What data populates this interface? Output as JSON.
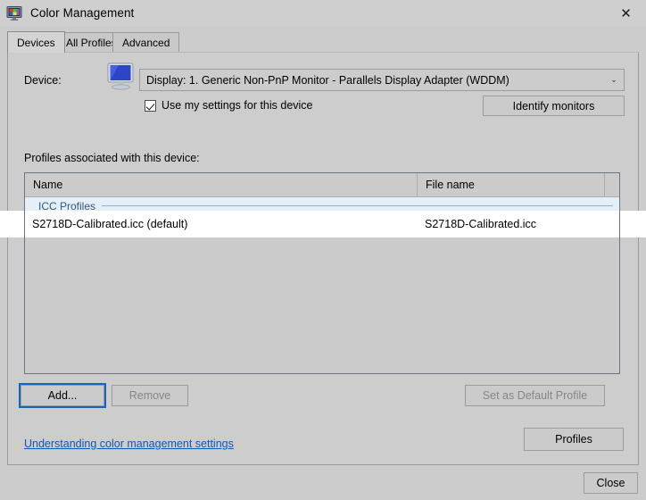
{
  "window": {
    "title": "Color Management",
    "icon": "color-monitor-icon",
    "close_glyph": "✕"
  },
  "tabs": [
    {
      "label": "Devices",
      "active": true
    },
    {
      "label": "All Profiles",
      "active": false
    },
    {
      "label": "Advanced",
      "active": false
    }
  ],
  "device": {
    "label": "Device:",
    "icon": "monitor-icon",
    "selected": "Display: 1. Generic Non-PnP Monitor - Parallels Display Adapter (WDDM)",
    "dropdown_glyph": "⌄",
    "use_my_settings": {
      "label": "Use my settings for this device",
      "checked": true
    },
    "identify_button": "Identify monitors"
  },
  "profiles": {
    "caption": "Profiles associated with this device:",
    "columns": [
      "Name",
      "File name",
      ""
    ],
    "group": "ICC Profiles",
    "rows": [
      {
        "name": "S2718D-Calibrated.icc (default)",
        "file": "S2718D-Calibrated.icc",
        "selected": true
      }
    ]
  },
  "actions": {
    "add": "Add...",
    "remove": "Remove",
    "set_default": "Set as Default Profile",
    "profiles": "Profiles",
    "close": "Close",
    "disabled": [
      "Remove",
      "Set as Default Profile"
    ]
  },
  "help_link": "Understanding color management settings",
  "colors": {
    "dialog_bg": "#cccccc",
    "panel_bg": "#cdcdcd",
    "link": "#0d59b5",
    "focus_ring": "#1565c0",
    "group_header_text": "#35567f",
    "group_header_bg": "#e5eff9",
    "row_bg": "#ffffff",
    "list_border": "#6e7480"
  }
}
